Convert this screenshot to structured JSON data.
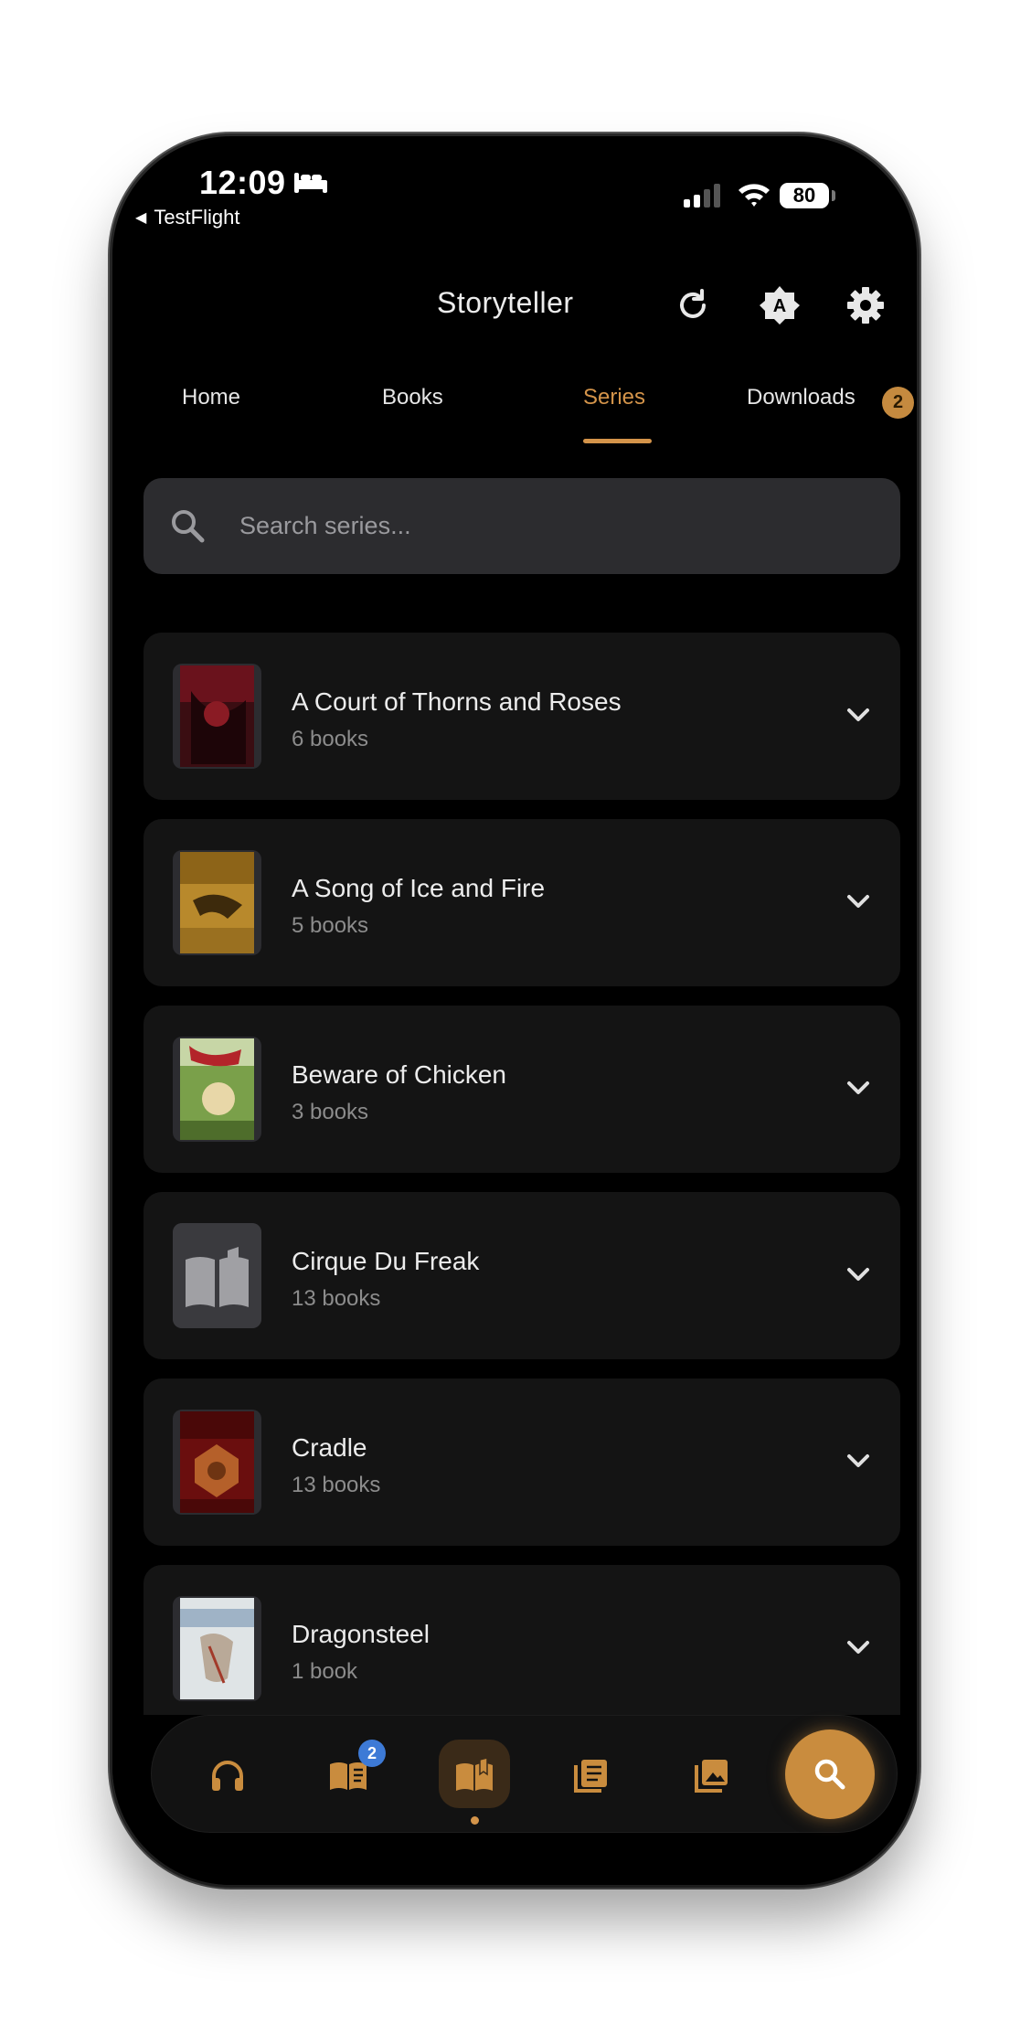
{
  "status_bar": {
    "time": "12:09",
    "back_label": "TestFlight",
    "battery": "80"
  },
  "header": {
    "title": "Storyteller"
  },
  "tabs": [
    {
      "label": "Home"
    },
    {
      "label": "Books"
    },
    {
      "label": "Series"
    },
    {
      "label": "Downloads",
      "badge": "2"
    }
  ],
  "active_tab": "Series",
  "search": {
    "placeholder": "Search series..."
  },
  "series": [
    {
      "title": "A Court of Thorns and Roses",
      "count": "6 books"
    },
    {
      "title": "A Song of Ice and Fire",
      "count": "5 books"
    },
    {
      "title": "Beware of Chicken",
      "count": "3 books"
    },
    {
      "title": "Cirque Du Freak",
      "count": "13 books"
    },
    {
      "title": "Cradle",
      "count": "13 books"
    },
    {
      "title": "Dragonsteel",
      "count": "1 book"
    }
  ],
  "bottom_nav": {
    "items": [
      "headphones-icon",
      "open-book-icon",
      "reader-icon",
      "library-icon",
      "gallery-icon"
    ],
    "book_badge": "2",
    "fab_icon": "search-icon"
  },
  "colors": {
    "accent": "#d4944a",
    "background": "#000000",
    "card": "#141414",
    "badge_blue": "#3d7ad6"
  }
}
